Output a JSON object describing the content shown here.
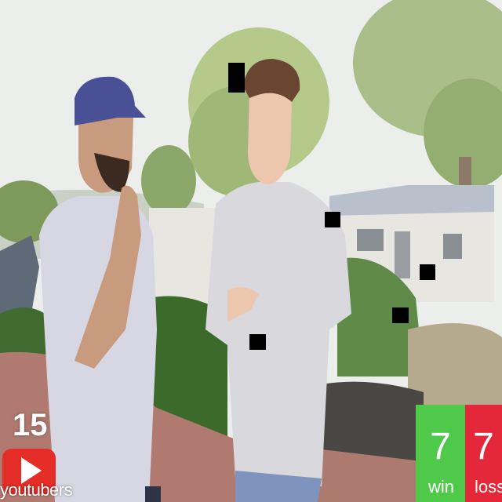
{
  "overlay": {
    "youtuber_count": "15",
    "youtuber_label": "youtubers",
    "wins_value": "7",
    "wins_label": "win",
    "losses_value": "7",
    "losses_label": "loss",
    "colors": {
      "youtube_red": "#e52d27",
      "win_green": "#4fc94a",
      "loss_red": "#e4283a"
    },
    "icons": [
      "youtube-play-icon"
    ]
  },
  "scene": {
    "description_tags": [
      "two-men-standing",
      "outdoor-hillside",
      "trees",
      "house"
    ]
  }
}
